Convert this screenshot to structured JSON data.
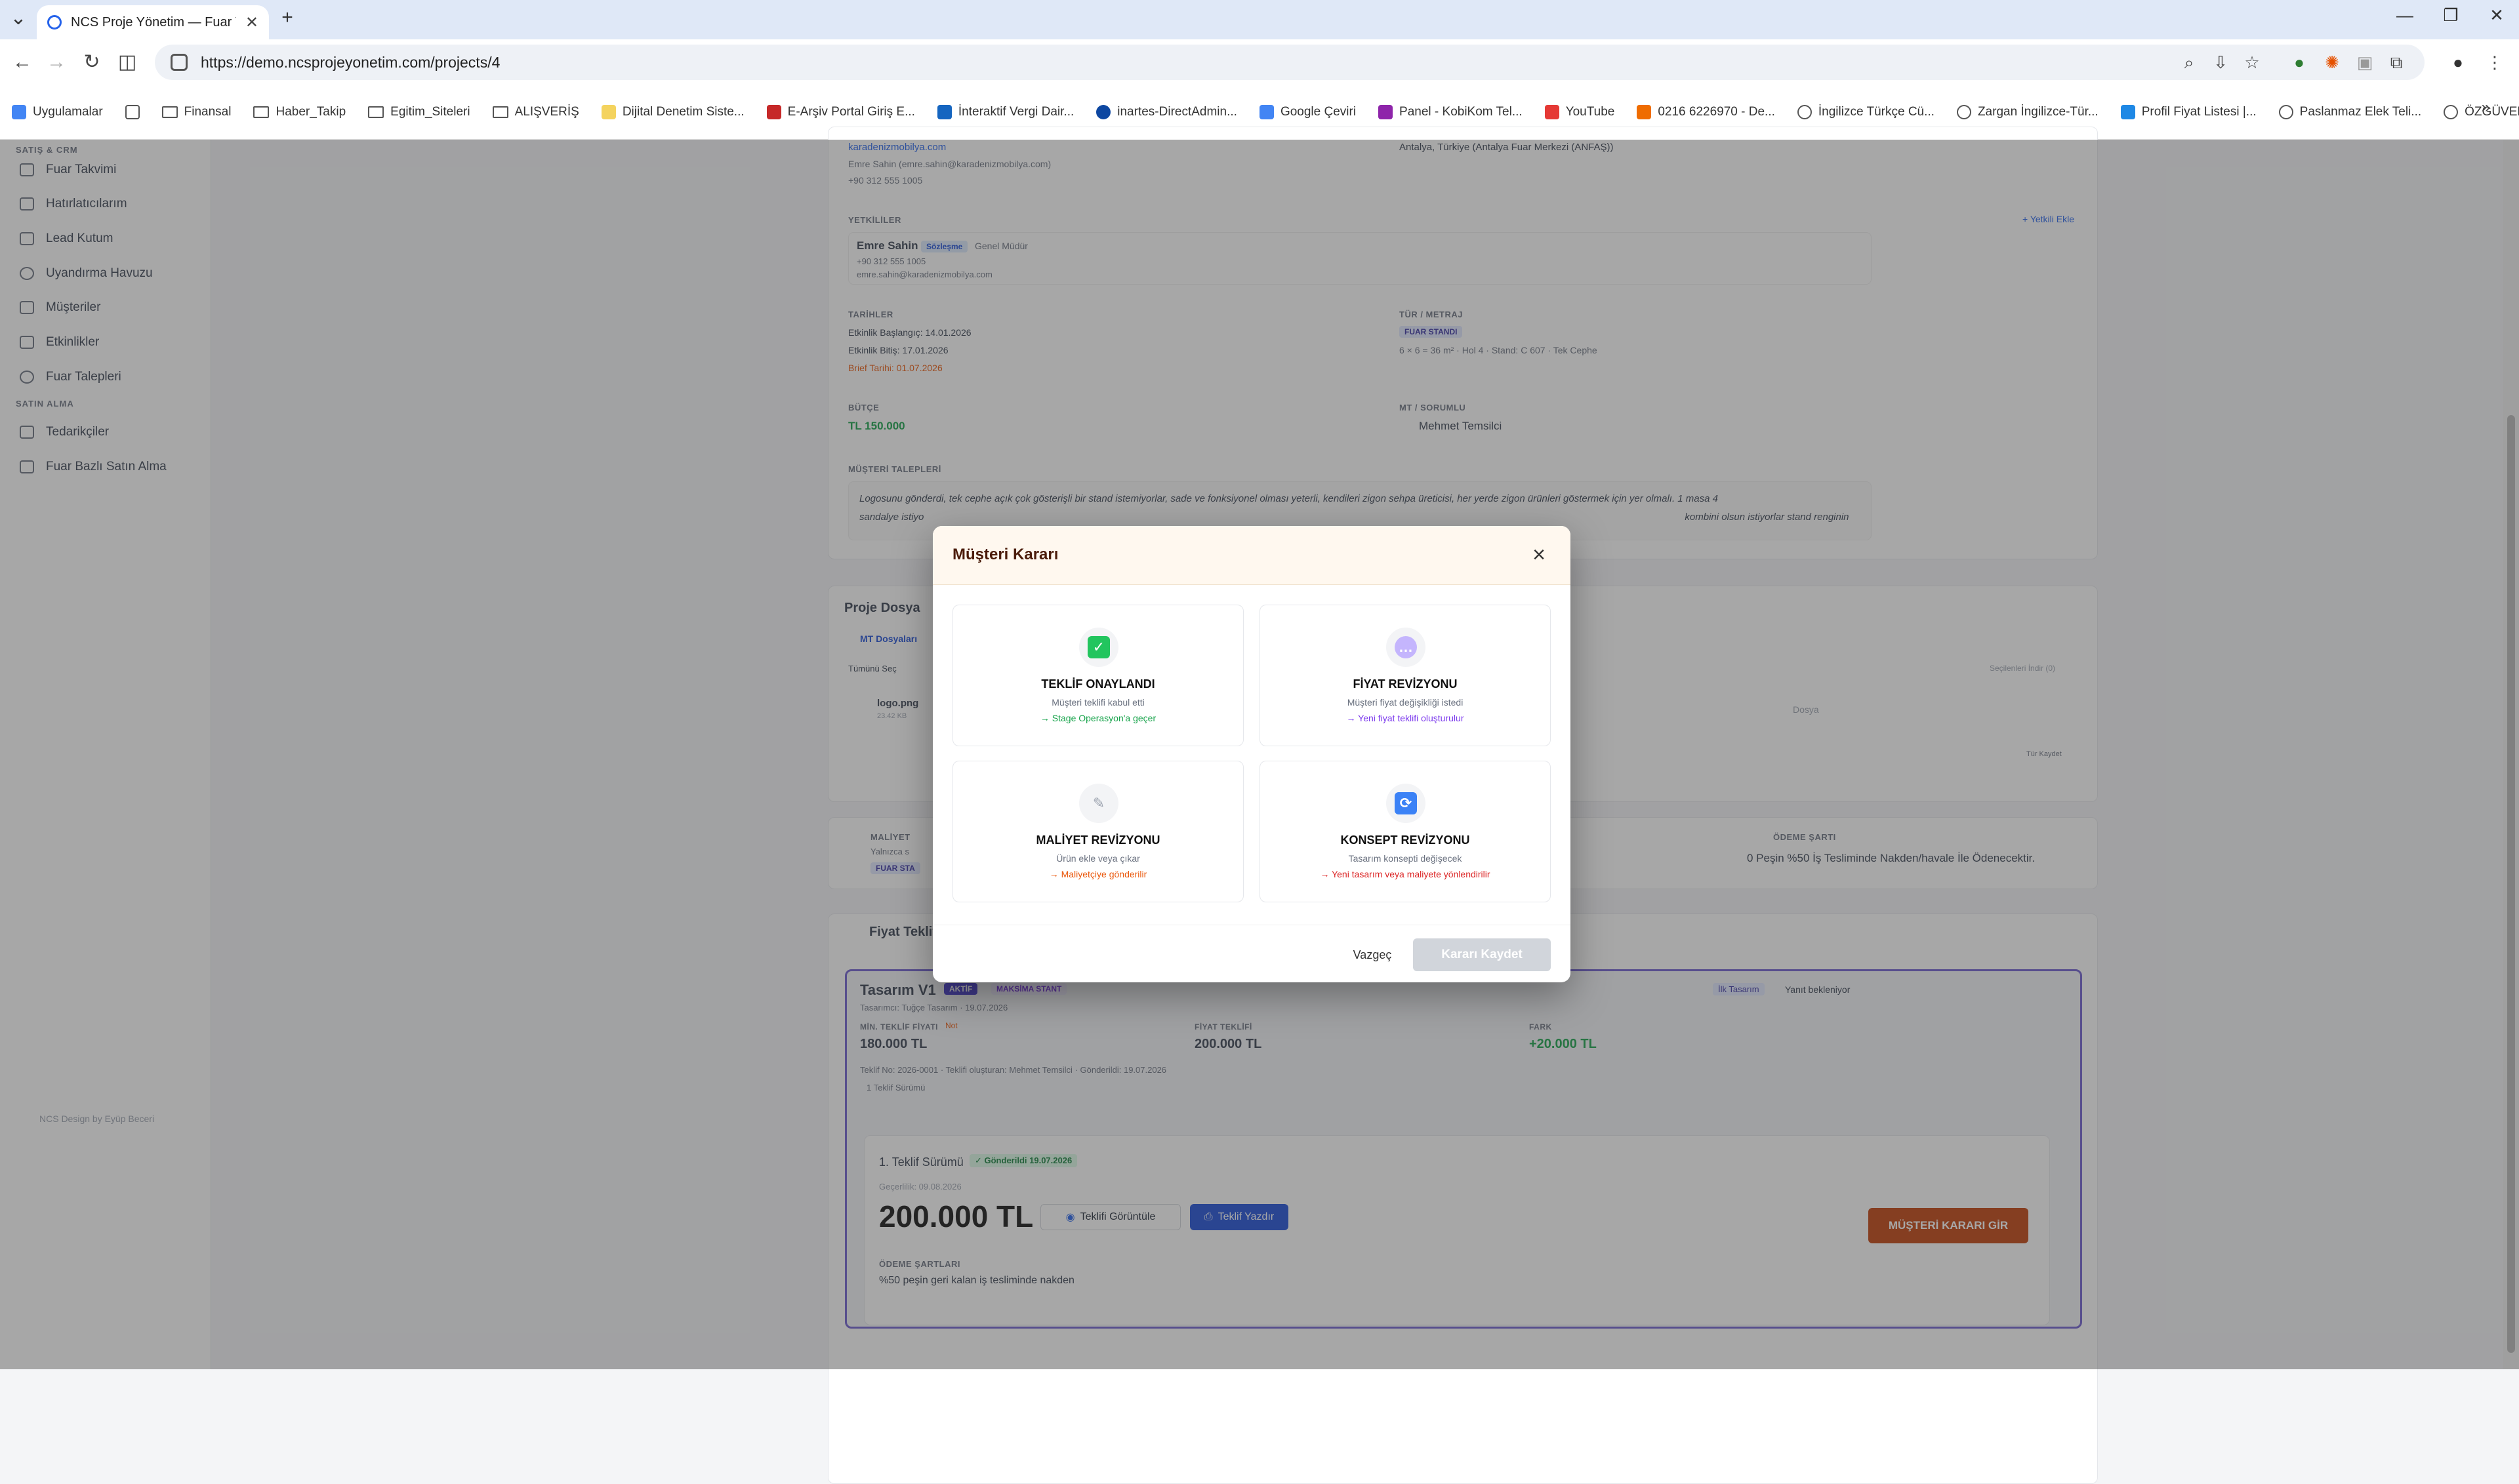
{
  "browser": {
    "tab_title": "NCS Proje Yönetim — Fuar Yön",
    "url": "https://demo.ncsprojeyonetim.com/projects/4",
    "bookmarks": [
      "Uygulamalar",
      "Finansal",
      "Haber_Takip",
      "Egitim_Siteleri",
      "ALIŞVERİŞ",
      "Dijital Denetim Siste...",
      "E-Arşiv Portal Giriş E...",
      "İnteraktif Vergi Dair...",
      "inartes-DirectAdmin...",
      "Google Çeviri",
      "Panel - KobiKom Tel...",
      "YouTube",
      "0216 6226970 - De...",
      "İngilizce Türkçe Cü...",
      "Zargan İngilizce-Tür...",
      "Profil Fiyat Listesi |...",
      "Paslanmaz Elek Teli...",
      "ÖZGÜVEN | Ebatlam..."
    ]
  },
  "sidebar": {
    "section_crm": "SATIŞ & CRM",
    "crm_items": [
      "Fuar Takvimi",
      "Hatırlatıcılarım",
      "Lead Kutum",
      "Uyandırma Havuzu",
      "Müşteriler",
      "Etkinlikler",
      "Fuar Talepleri"
    ],
    "section_purchase": "SATIN ALMA",
    "purchase_items": [
      "Tedarikçiler",
      "Fuar Bazlı Satın Alma"
    ],
    "credit": "NCS Design by Eyüp Beceri"
  },
  "project": {
    "website": "karadenizmobilya.com",
    "contact_line": "Emre Sahin (emre.sahin@karadenizmobilya.com)",
    "phone": "+90 312 555 1005",
    "location": "Antalya, Türkiye (Antalya Fuar Merkezi (ANFAŞ))",
    "yetkililer_label": "YETKİLİLER",
    "add_yetkili": "+ Yetkili Ekle",
    "yetkili_name": "Emre Sahin",
    "yetkili_badge": "Sözleşme",
    "yetkili_role": "Genel Müdür",
    "yetkili_phone": "+90 312 555 1005",
    "yetkili_email": "emre.sahin@karadenizmobilya.com",
    "tarihler_label": "TARİHLER",
    "start": "Etkinlik Başlangıç: 14.01.2026",
    "end": "Etkinlik Bitiş: 17.01.2026",
    "brief": "Brief Tarihi: 01.07.2026",
    "tur_label": "TÜR / METRAJ",
    "tur_badge": "FUAR STANDI",
    "tur_detail": "6 × 6 = 36 m² · Hol 4 · Stand: C 607 · Tek Cephe",
    "butce_label": "BÜTÇE",
    "butce": "TL 150.000",
    "mt_label": "MT / SORUMLU",
    "mt": "Mehmet Temsilci",
    "talepler_label": "MÜŞTERİ TALEPLERİ",
    "talepler_1": "Logosunu gönderdi, tek cephe açık çok gösterişli bir stand istemiyorlar, sade ve fonksiyonel olması yeterli, kendileri zigon sehpa üreticisi, her yerde zigon ürünleri göstermek için yer olmalı. 1 masa 4",
    "talepler_2": "sandalye istiyo",
    "talepler_3": "kombini olsun istiyorlar stand renginin"
  },
  "files": {
    "title": "Proje Dosya",
    "mt_files": "MT Dosyaları",
    "select_all": "Tümünü Seç",
    "file_name": "logo.png",
    "file_size": "23.42 KB",
    "dosya": "Dosya",
    "download_sel": "Seçilenleri İndir (0)",
    "view": "Tür Kaydet"
  },
  "payment": {
    "label": "MALİYET",
    "sub": "Yalnızca s",
    "badge": "FUAR STA",
    "cond_label": "ÖDEME ŞARTI",
    "cond": "0 Peşin %50 İş Tesliminde Nakden/havale İle Ödenecektir."
  },
  "offer": {
    "section": "Fiyat Teklif",
    "design": "Tasarım V1",
    "active": "AKTİF",
    "maxima": "MAKSİMA STANT",
    "designer": "Tasarımcı: Tuğçe Tasarım · 19.07.2026",
    "min_label": "MİN. TEKLİF FİYATI",
    "min_note": "Not",
    "min_value": "180.000 TL",
    "price_label": "FİYAT TEKLİFİ",
    "price_value": "200.000 TL",
    "diff_label": "FARK",
    "diff_value": "+20.000 TL",
    "meta": "Teklif No: 2026-0001 · Teklifi oluşturan: Mehmet Temsilci · Gönderildi: 19.07.2026",
    "versions": "1 Teklif Sürümü",
    "tag_first": "İlk Tasarım",
    "tag_wait": "Yanıt bekleniyor",
    "version_title": "1. Teklif Sürümü",
    "sent_badge": "✓ Gönderildi 19.07.2026",
    "valid": "Geçerlilik: 09.08.2026",
    "big_price": "200.000 TL",
    "view_btn": "Teklifi Görüntüle",
    "print_btn": "Teklif Yazdır",
    "decision_btn": "MÜŞTERİ KARARI GİR",
    "terms_label": "ÖDEME ŞARTLARI",
    "terms": "%50 peşin geri kalan iş tesliminde nakden"
  },
  "modal": {
    "title": "Müşteri Kararı",
    "options": [
      {
        "title": "TEKLİF ONAYLANDI",
        "desc": "Müşteri teklifi kabul etti",
        "note": "→ Stage Operasyon'a geçer",
        "note_color": "#16a34a",
        "icon": "check-icon",
        "icon_color": "#22c55e"
      },
      {
        "title": "FİYAT REVİZYONU",
        "desc": "Müşteri fiyat değişikliği istedi",
        "note": "→ Yeni fiyat teklifi oluşturulur",
        "note_color": "#7c3aed",
        "icon": "chat-icon",
        "icon_color": "#a78bfa"
      },
      {
        "title": "MALİYET REVİZYONU",
        "desc": "Ürün ekle veya çıkar",
        "note": "→ Maliyetçiye gönderilir",
        "note_color": "#ea580c",
        "icon": "wrench-icon",
        "icon_color": "#9ca3af"
      },
      {
        "title": "KONSEPT REVİZYONU",
        "desc": "Tasarım konsepti değişecek",
        "note": "→ Yeni tasarım veya maliyete yönlendirilir",
        "note_color": "#dc2626",
        "icon": "refresh-icon",
        "icon_color": "#3b82f6"
      }
    ],
    "cancel": "Vazgeç",
    "save": "Kararı Kaydet"
  }
}
